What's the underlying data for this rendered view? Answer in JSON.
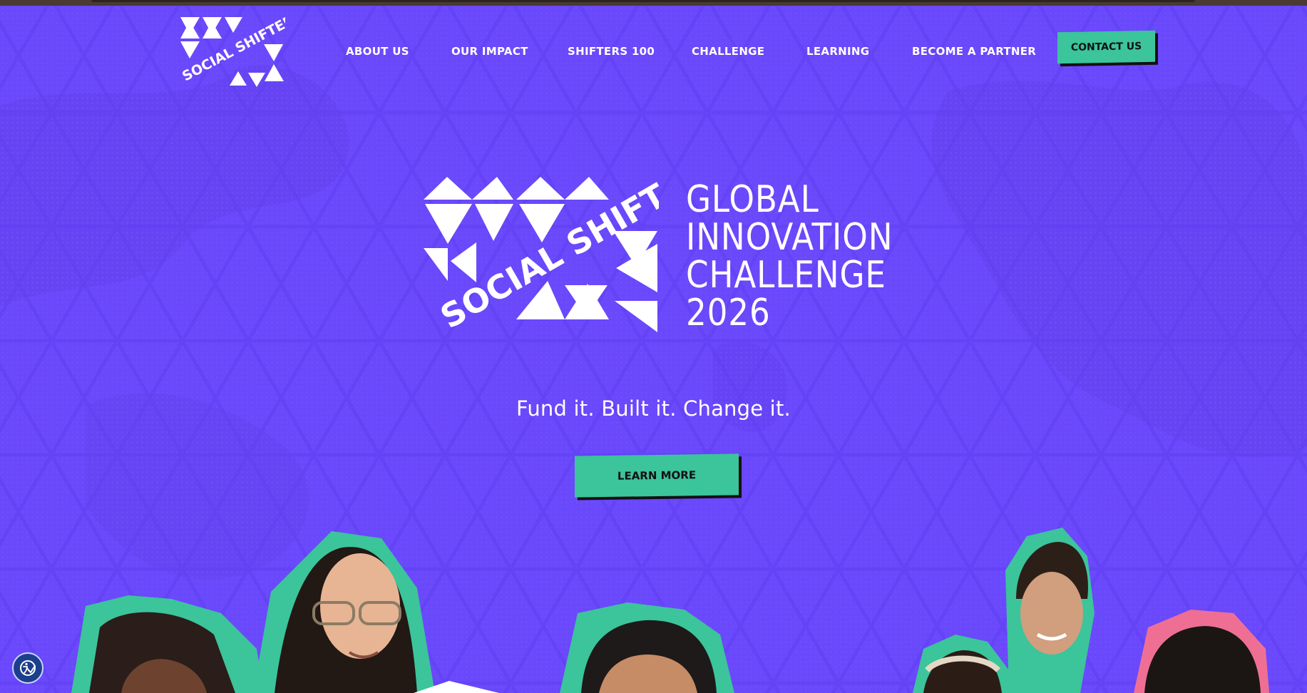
{
  "brand": {
    "logo_text": "SOCIAL SHIFTERS",
    "accent_color": "#3cc49b",
    "background_color": "#6847f9",
    "portrait_outline_colors": [
      "#3cc49b",
      "#ef6f94"
    ]
  },
  "nav": {
    "items": [
      {
        "label": "ABOUT US"
      },
      {
        "label": "OUR IMPACT"
      },
      {
        "label": "SHIFTERS 100"
      },
      {
        "label": "CHALLENGE"
      },
      {
        "label": "LEARNING"
      },
      {
        "label": "BECOME A PARTNER"
      }
    ],
    "contact_label": "CONTACT US"
  },
  "hero": {
    "title_lines": [
      "GLOBAL",
      "INNOVATION",
      "CHALLENGE",
      "2026"
    ],
    "tagline": "Fund it. Built it. Change it.",
    "cta_label": "LEARN MORE"
  },
  "icons": {
    "accessibility": "accessibility-icon"
  }
}
